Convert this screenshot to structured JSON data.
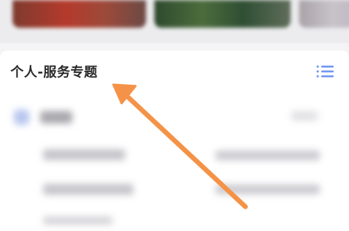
{
  "section": {
    "title": "个人-服务专题"
  },
  "icons": {
    "menu": "list-menu-icon",
    "arrow": "annotation-arrow"
  },
  "colors": {
    "accent_blue": "#6e95f2",
    "annotation_orange": "#f49348",
    "card_background": "#ffffff",
    "page_background": "#f4f4f6",
    "title_text": "#2a2a2a"
  }
}
